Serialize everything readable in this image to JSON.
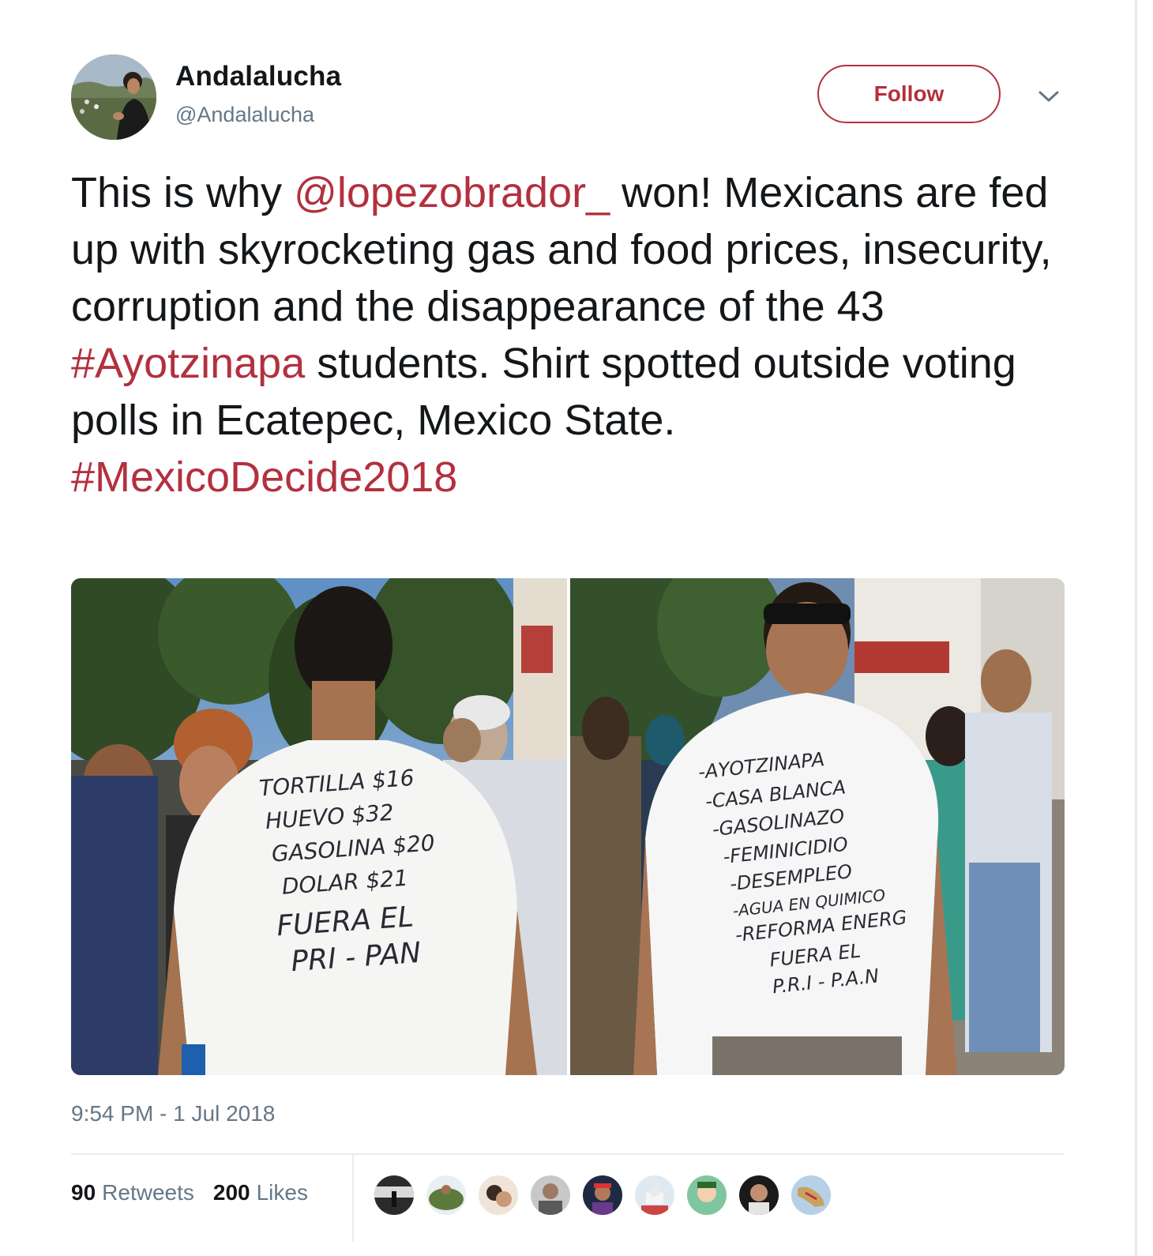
{
  "user": {
    "display_name": "Andalalucha",
    "screen_name": "@Andalalucha",
    "avatar_icon": "profile-avatar"
  },
  "header": {
    "follow_label": "Follow",
    "caret_icon": "chevron-down-icon"
  },
  "tweet": {
    "text_1": "This is why ",
    "mention": "@lopezobrador_",
    "text_2": " won! Mexicans are fed up with skyrocketing gas and food prices, insecurity, corruption and the disappearance of the 43 ",
    "hashtag_1": "#Ayotzinapa",
    "text_3": " students. Shirt spotted outside voting polls in Ecatepec, Mexico State.",
    "hashtag_2": "#MexicoDecide2018"
  },
  "media": {
    "left_shirt_lines": [
      "TORTILLA $16",
      "HUEVO $32",
      "GASOLINA $20",
      "DOLAR $21",
      "FUERA EL",
      "PRI - PAN"
    ],
    "right_shirt_lines": [
      "-AYOTZINAPA",
      "-CASA BLANCA",
      "-GASOLINAZO",
      "-FEMINICIDIO",
      "-DESEMPLEO",
      "-AGUA EN QUIMICO",
      "-REFORMA ENERG",
      "FUERA EL",
      "P.R.I - P.A.N"
    ]
  },
  "timestamp": "9:54 PM - 1 Jul 2018",
  "stats": {
    "retweets_count": "90",
    "retweets_label": "Retweets",
    "likes_count": "200",
    "likes_label": "Likes"
  },
  "colors": {
    "accent": "#b3303e",
    "secondary_text": "#657786",
    "primary_text": "#14171a"
  }
}
